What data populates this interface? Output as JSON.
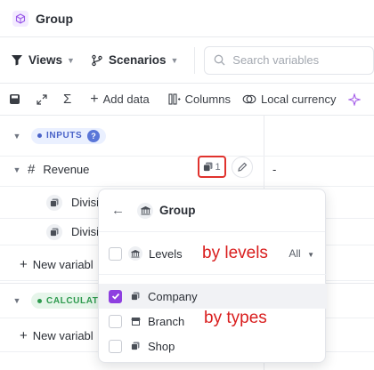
{
  "header": {
    "title": "Group",
    "icon": "cube-icon"
  },
  "viewsbar": {
    "views_label": "Views",
    "scenarios_label": "Scenarios",
    "search_placeholder": "Search variables"
  },
  "toolbar": {
    "add_data_label": "Add data",
    "columns_label": "Columns",
    "local_currency_label": "Local currency"
  },
  "grid": {
    "inputs_section": {
      "label": "INPUTS",
      "help": "?"
    },
    "revenue_row": {
      "label": "Revenue",
      "value": "-",
      "dimension_count": "1"
    },
    "division_rows": [
      {
        "label": "Divisi"
      },
      {
        "label": "Divisi"
      }
    ],
    "new_variable_label": "New variabl",
    "calculations_section": {
      "label": "CALCULAT"
    },
    "new_variable_label_2": "New variabl"
  },
  "popup": {
    "header_label": "Group",
    "levels": {
      "label": "Levels",
      "checked": false,
      "filter_value": "All"
    },
    "types": [
      {
        "label": "Company",
        "checked": true
      },
      {
        "label": "Branch",
        "checked": false
      },
      {
        "label": "Shop",
        "checked": false
      }
    ]
  },
  "annotations": {
    "levels_note": "by levels",
    "types_note": "by types"
  },
  "colors": {
    "accent_purple": "#8e3fe0",
    "inputs_blue": "#4a63c8",
    "calc_green": "#2e9a4e",
    "highlight_red": "#e0322d",
    "annotation_red": "#d91e1e"
  }
}
